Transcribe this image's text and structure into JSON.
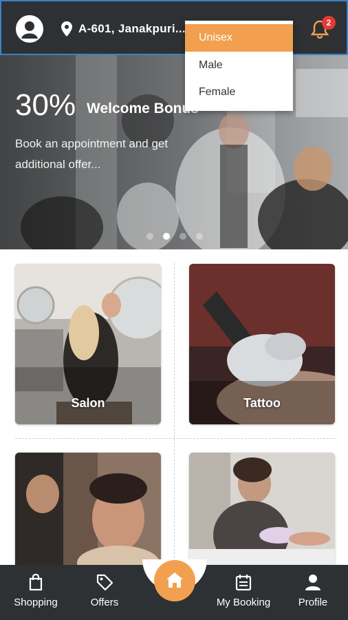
{
  "header": {
    "location": "A-601, Janakpuri...",
    "notification_count": "2",
    "accent": "#f2a04f"
  },
  "gender_dropdown": {
    "options": [
      "Unisex",
      "Male",
      "Female"
    ],
    "selected": "Unisex"
  },
  "banner": {
    "percent": "30%",
    "title": "Welcome Bonus",
    "subtitle": "Book an appointment and get additional offer...",
    "slide_count": 4,
    "active_slide": 2
  },
  "categories": [
    {
      "label": "Salon"
    },
    {
      "label": "Tattoo"
    },
    {
      "label": ""
    },
    {
      "label": ""
    }
  ],
  "nav": {
    "items": [
      {
        "label": "Shopping",
        "icon": "shopping-bag-icon"
      },
      {
        "label": "Offers",
        "icon": "tag-icon"
      },
      {
        "label": "My Booking",
        "icon": "calendar-icon"
      },
      {
        "label": "Profile",
        "icon": "person-icon"
      }
    ],
    "center_icon": "home-icon"
  },
  "colors": {
    "dark_bar": "#2e3133",
    "accent": "#f2a04f",
    "badge": "#e53935"
  }
}
